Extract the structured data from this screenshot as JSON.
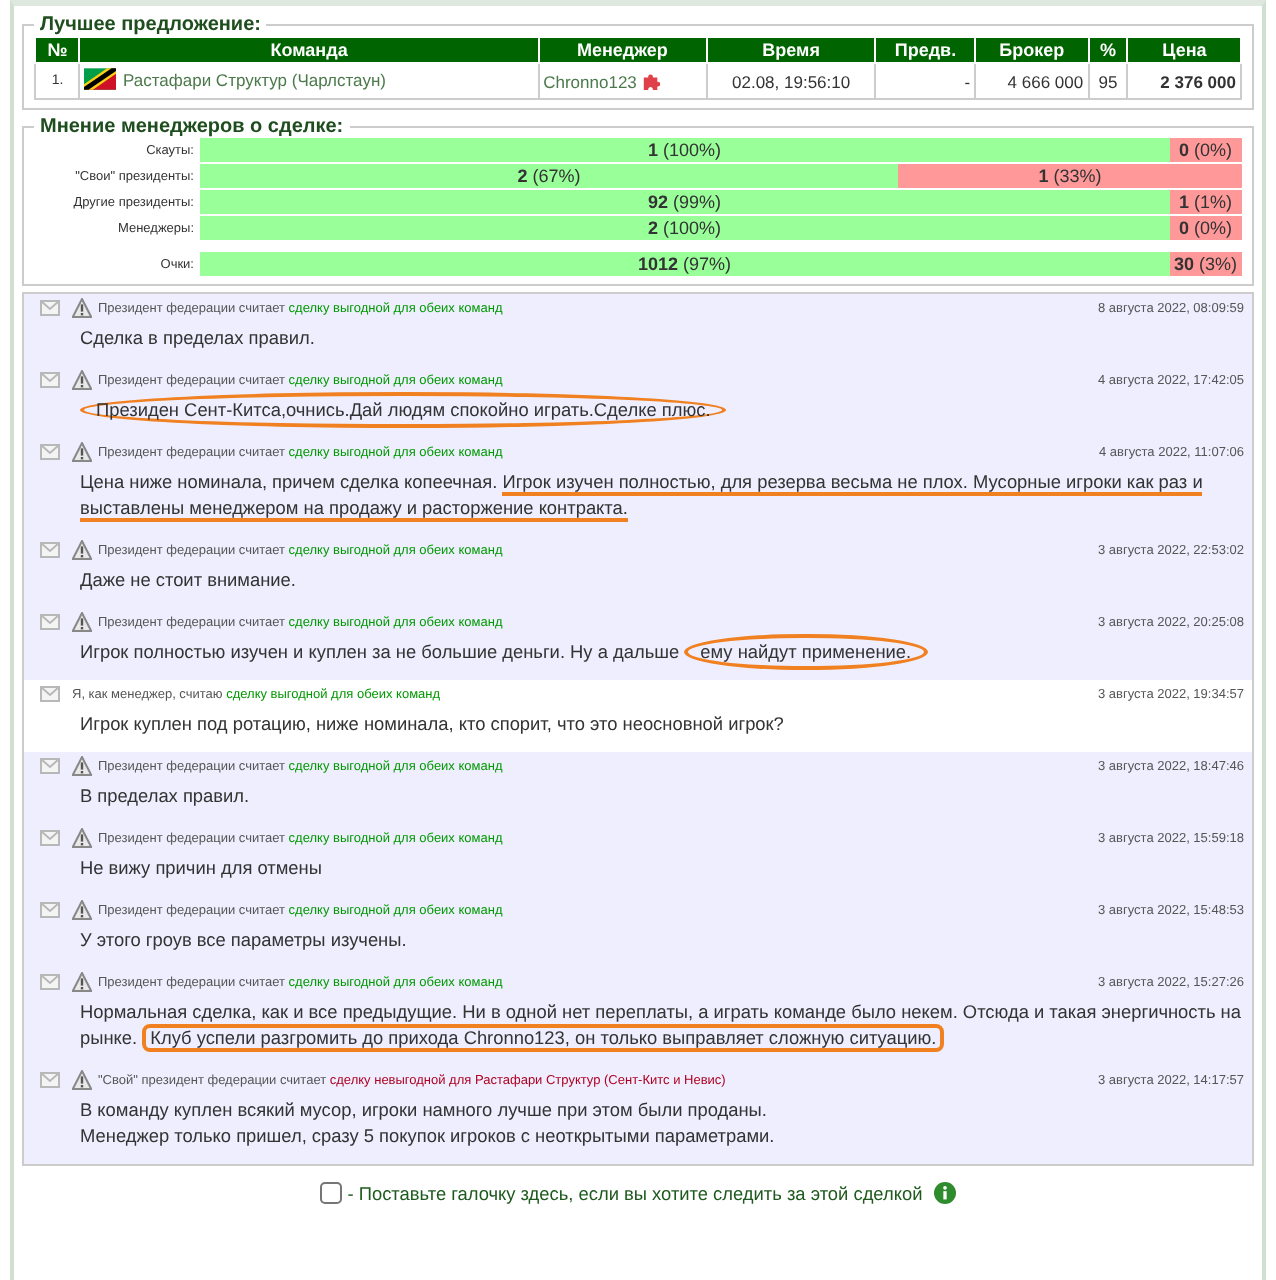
{
  "best_offer": {
    "legend": "Лучшее предложение:",
    "columns": [
      "№",
      "Команда",
      "Менеджер",
      "Время",
      "Предв.",
      "Брокер",
      "%",
      "Цена"
    ],
    "rows": [
      {
        "number": "1.",
        "team": "Растафари Структур (Чарлстаун)",
        "manager": "Chronno123",
        "time": "02.08, 19:56:10",
        "prev": "-",
        "broker": "4 666 000",
        "percent": "95",
        "price": "2 376 000"
      }
    ]
  },
  "opinions": {
    "legend": "Мнение менеджеров о сделке:",
    "rows": [
      {
        "kind": "votes",
        "label": "Скауты:",
        "yes": "**1** (100%)",
        "no": "**0** (0%)",
        "level": 0.93
      },
      {
        "kind": "votes",
        "label": "\"Свои\" президенты:",
        "yes": "**2** (67%)",
        "no": "**1** (33%)",
        "level": 0.67
      },
      {
        "kind": "votes",
        "label": "Другие президенты:",
        "yes": "**92** (99%)",
        "no": "**1** (1%)",
        "level": 0.93
      },
      {
        "kind": "votes",
        "label": "Менеджеры:",
        "yes": "**2** (100%)",
        "no": "**0** (0%)",
        "level": 0.93
      },
      {
        "kind": "total",
        "label": "Очки:",
        "yes": "**1012** (97%)",
        "no": "**30** (3%)",
        "level": 0.93
      }
    ]
  },
  "comments": [
    {
      "kind": "president",
      "prefix": "Президент федерации считает",
      "favorable": true,
      "verdict_text": "сделку выгодной для обеих команд",
      "date": "8 августа 2022, 08:09:59",
      "lines": [
        [
          {
            "kind": "plain",
            "text": "Сделка в пределах правил."
          }
        ]
      ]
    },
    {
      "kind": "president",
      "prefix": "Президент федерации считает",
      "favorable": true,
      "verdict_text": "сделку выгодной для обеих команд",
      "date": "4 августа 2022, 17:42:05",
      "lines": [
        [
          {
            "kind": "ellipse",
            "text": "Президен Сент-Китса,очнись.Дай людям спокойно играть.Сделке плюс."
          }
        ]
      ]
    },
    {
      "kind": "president",
      "prefix": "Президент федерации считает",
      "favorable": true,
      "verdict_text": "сделку выгодной для обеих команд",
      "date": "4 августа 2022, 11:07:06",
      "lines": [
        [
          {
            "kind": "plain",
            "text": "Цена ниже номинала, причем сделка копеечная. "
          },
          {
            "kind": "underline",
            "text": "Игрок изучен полностью, для резерва весьма не плох. Мусорные игроки как раз и выставлены менеджером на продажу и расторжение контракта."
          }
        ]
      ]
    },
    {
      "kind": "president",
      "prefix": "Президент федерации считает",
      "favorable": true,
      "verdict_text": "сделку выгодной для обеих команд",
      "date": "3 августа 2022, 22:53:02",
      "lines": [
        [
          {
            "kind": "plain",
            "text": "Даже не стоит внимание."
          }
        ]
      ]
    },
    {
      "kind": "president",
      "prefix": "Президент федерации считает",
      "favorable": true,
      "verdict_text": "сделку выгодной для обеих команд",
      "date": "3 августа 2022, 20:25:08",
      "lines": [
        [
          {
            "kind": "plain",
            "text": "Игрок полностью изучен и куплен за не большие деньги. Ну а дальше "
          },
          {
            "kind": "ellipse",
            "text": "ему найдут применение."
          }
        ]
      ]
    },
    {
      "kind": "manager",
      "prefix": "Я, как менеджер, считаю",
      "favorable": true,
      "verdict_text": "сделку выгодной для обеих команд",
      "date": "3 августа 2022, 19:34:57",
      "lines": [
        [
          {
            "kind": "plain",
            "text": "Игрок куплен под ротацию, ниже номинала, кто спорит, что это неосновной игрок?"
          }
        ]
      ]
    },
    {
      "kind": "president",
      "prefix": "Президент федерации считает",
      "favorable": true,
      "verdict_text": "сделку выгодной для обеих команд",
      "date": "3 августа 2022, 18:47:46",
      "lines": [
        [
          {
            "kind": "plain",
            "text": "В пределах правил."
          }
        ]
      ]
    },
    {
      "kind": "president",
      "prefix": "Президент федерации считает",
      "favorable": true,
      "verdict_text": "сделку выгодной для обеих команд",
      "date": "3 августа 2022, 15:59:18",
      "lines": [
        [
          {
            "kind": "plain",
            "text": "Не вижу причин для отмены"
          }
        ]
      ]
    },
    {
      "kind": "president",
      "prefix": "Президент федерации считает",
      "favorable": true,
      "verdict_text": "сделку выгодной для обеих команд",
      "date": "3 августа 2022, 15:48:53",
      "lines": [
        [
          {
            "kind": "plain",
            "text": "У этого гроув все параметры изучены."
          }
        ]
      ]
    },
    {
      "kind": "president",
      "prefix": "Президент федерации считает",
      "favorable": true,
      "verdict_text": "сделку выгодной для обеих команд",
      "date": "3 августа 2022, 15:27:26",
      "lines": [
        [
          {
            "kind": "plain",
            "text": "Нормальная сделка, как и все предыдущие. Ни в одной нет переплаты, а играть команде было некем. Отсюда и такая энергичность на рынке. "
          },
          {
            "kind": "box",
            "text": "Клуб успели разгромить до прихода Chronno123, он только выправляет сложную ситуацию."
          }
        ]
      ]
    },
    {
      "kind": "president",
      "prefix": "\"Свой\" президент федерации считает",
      "favorable": false,
      "verdict_text": "сделку невыгодной для Растафари Структур (Сент-Китс и Невис)",
      "date": "3 августа 2022, 14:17:57",
      "lines": [
        [
          {
            "kind": "plain",
            "text": "В команду куплен всякий мусор, игроки намного лучше при этом были проданы."
          }
        ],
        [
          {
            "kind": "plain",
            "text": "Менеджер только пришел, сразу 5 покупок игроков с неоткрытыми параметрами."
          }
        ]
      ]
    }
  ],
  "follow": {
    "checked": false,
    "label": "- Поставьте галочку здесь, если вы хотите следить за этой сделкой"
  }
}
